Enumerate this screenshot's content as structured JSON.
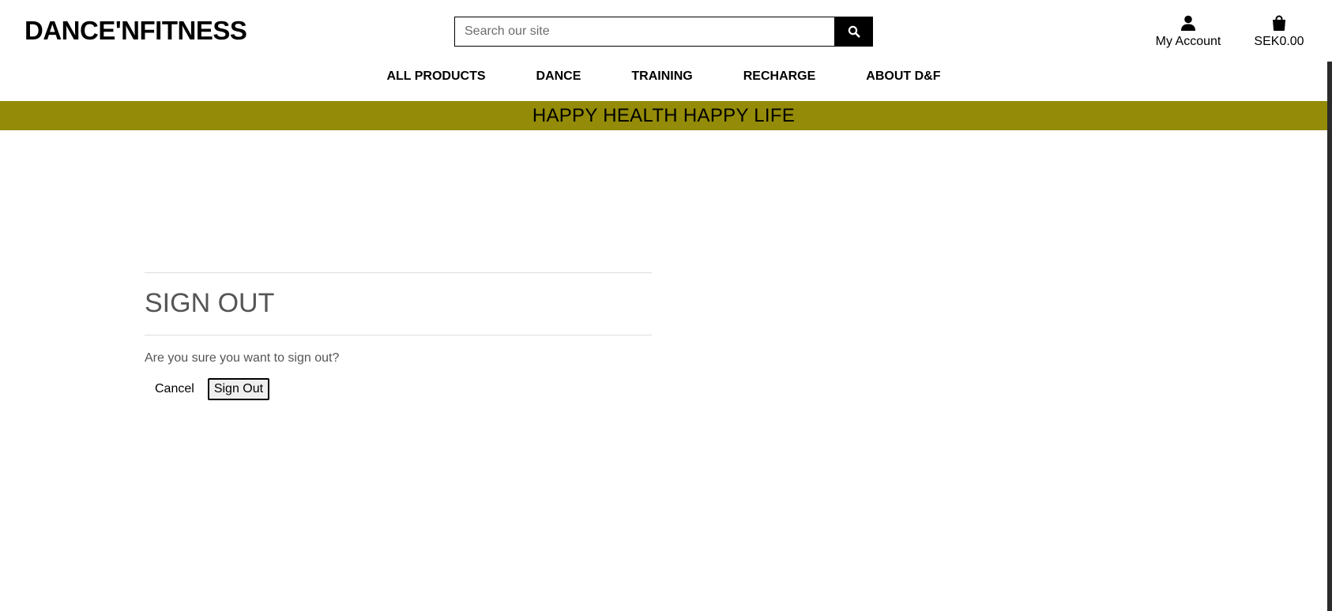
{
  "header": {
    "brand": "DANCE'NFITNESS",
    "search": {
      "placeholder": "Search our site",
      "button_icon": "search-icon"
    },
    "account": {
      "label": "My Account",
      "icon": "user-icon"
    },
    "bag": {
      "label": "SEK0.00",
      "icon": "shopping-bag-icon"
    }
  },
  "nav": {
    "items": [
      {
        "label": "ALL PRODUCTS"
      },
      {
        "label": "DANCE"
      },
      {
        "label": "TRAINING"
      },
      {
        "label": "RECHARGE"
      },
      {
        "label": "ABOUT D&F"
      }
    ]
  },
  "banner": {
    "text": "HAPPY HEALTH HAPPY LIFE",
    "color": "#948b09"
  },
  "signout": {
    "title": "SIGN OUT",
    "question": "Are you sure you want to sign out?",
    "cancel_label": "Cancel",
    "submit_label": "Sign Out"
  }
}
